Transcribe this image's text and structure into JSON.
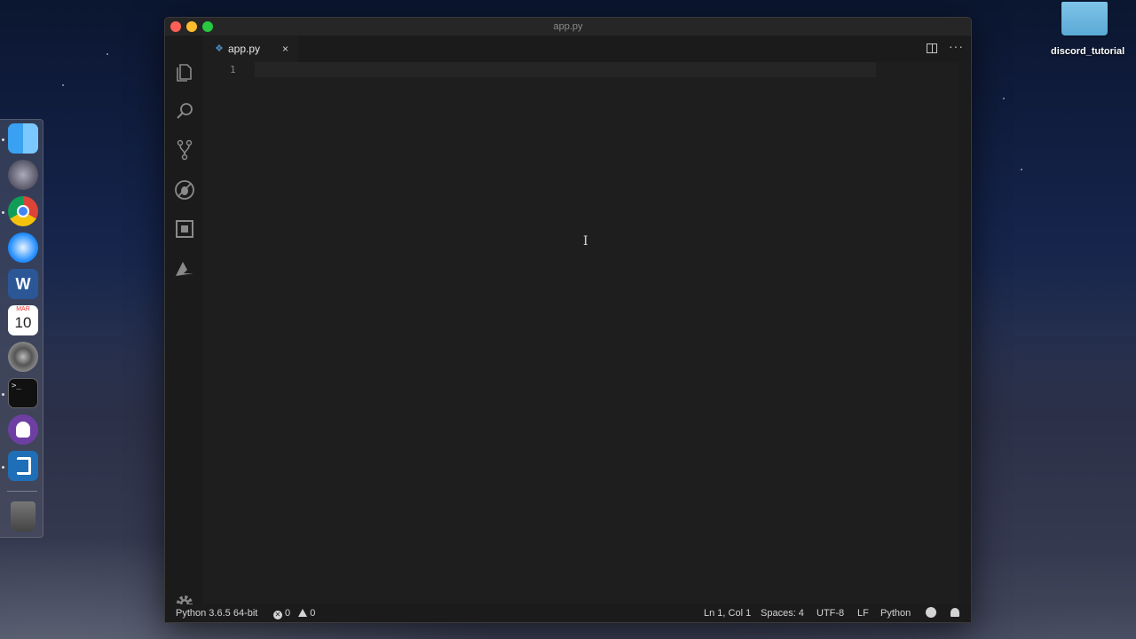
{
  "window": {
    "title": "app.py"
  },
  "tab": {
    "label": "app.py",
    "close_glyph": "×"
  },
  "editor": {
    "line_numbers": [
      "1"
    ]
  },
  "desktop": {
    "folder_label": "discord_tutorial"
  },
  "statusbar": {
    "interpreter": "Python 3.6.5 64-bit",
    "errors": "0",
    "warnings": "0",
    "position": "Ln 1, Col 1",
    "spaces": "Spaces: 4",
    "encoding": "UTF-8",
    "eol": "LF",
    "language": "Python"
  },
  "dock": {
    "calendar_month": "MAR",
    "calendar_day": "10",
    "terminal_prompt": ">_"
  },
  "colors": {
    "accent": "#4b8bbe",
    "editor_bg": "#1e1e1e",
    "statusbar_bg": "#1b1b1b"
  }
}
